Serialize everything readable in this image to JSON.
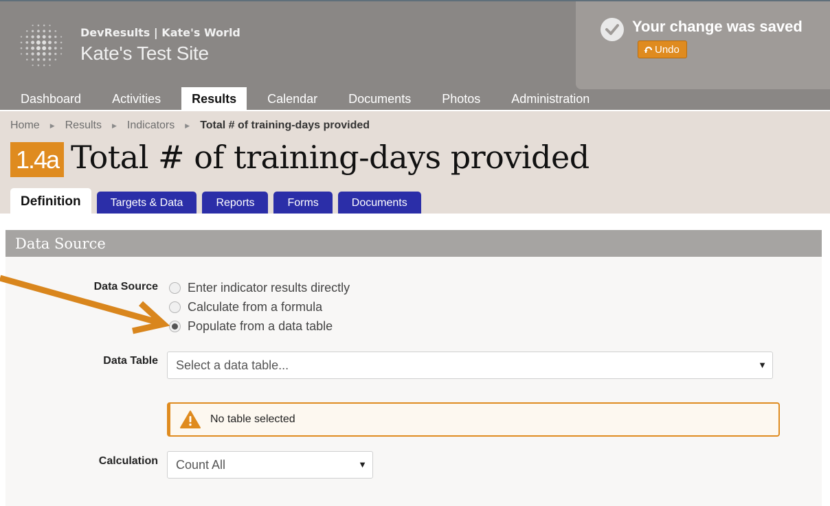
{
  "header": {
    "org_line": "DevResults | Kate's World",
    "site_name": "Kate's Test Site",
    "logo_icon": "globe-dots-logo"
  },
  "nav": {
    "items": [
      {
        "label": "Dashboard"
      },
      {
        "label": "Activities"
      },
      {
        "label": "Results",
        "active": true
      },
      {
        "label": "Calendar"
      },
      {
        "label": "Documents"
      },
      {
        "label": "Photos"
      },
      {
        "label": "Administration"
      }
    ]
  },
  "toast": {
    "message": "Your change was saved",
    "undo_label": "Undo",
    "icon": "check-circle-icon"
  },
  "breadcrumb": {
    "items": [
      "Home",
      "Results",
      "Indicators"
    ],
    "current": "Total # of training-days provided"
  },
  "indicator": {
    "code": "1.4a",
    "title": "Total # of training-days provided"
  },
  "tabs": [
    {
      "label": "Definition",
      "active": true
    },
    {
      "label": "Targets & Data"
    },
    {
      "label": "Reports"
    },
    {
      "label": "Forms"
    },
    {
      "label": "Documents"
    }
  ],
  "panel": {
    "heading": "Data Source",
    "data_source_label": "Data Source",
    "options": [
      {
        "label": "Enter indicator results directly",
        "checked": false
      },
      {
        "label": "Calculate from a formula",
        "checked": false
      },
      {
        "label": "Populate from a data table",
        "checked": true
      }
    ],
    "data_table_label": "Data Table",
    "data_table_placeholder": "Select a data table...",
    "warning_text": "No table selected",
    "calculation_label": "Calculation",
    "calculation_value": "Count All"
  },
  "colors": {
    "accent_orange": "#df8b1f",
    "tab_blue": "#2b2ea8",
    "header_gray": "#8a8785"
  }
}
